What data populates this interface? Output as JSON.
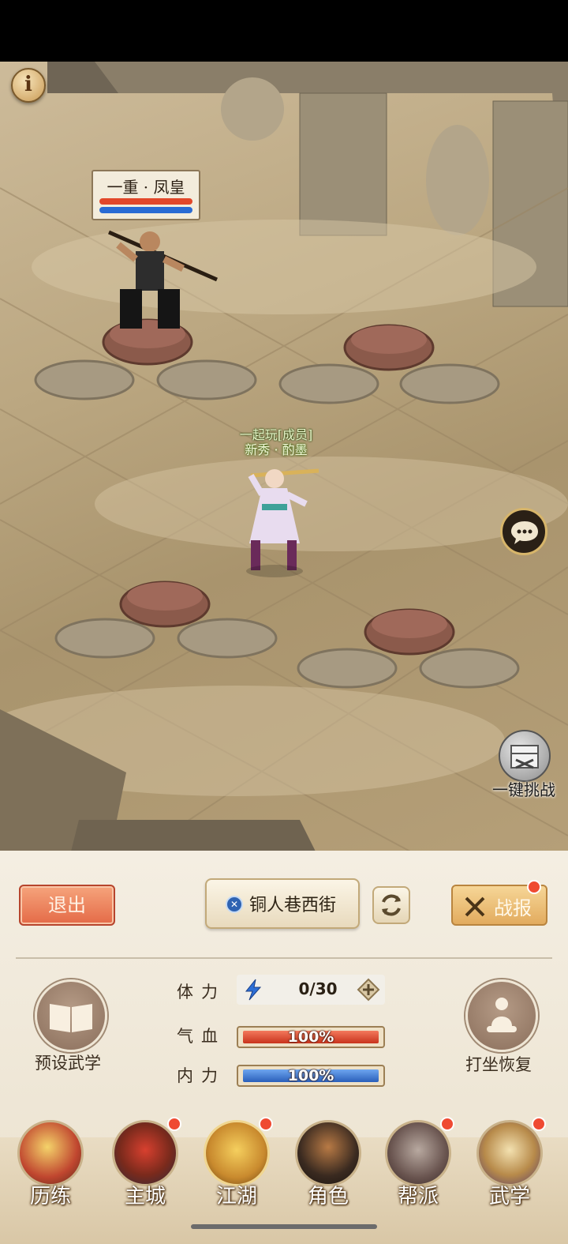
{
  "scene": {
    "enemy": {
      "name": "一重 · 凤皇",
      "hp_percent": 100,
      "mp_percent": 100
    },
    "player": {
      "guild_tag": "一起玩[成员]",
      "name": "新秀 · 酌墨"
    },
    "auto_challenge_label": "一键挑战"
  },
  "controls": {
    "exit_label": "退出",
    "location_label": "铜人巷西街",
    "report_label": "战报"
  },
  "stats": {
    "stamina_label": "体力",
    "stamina_value": "0/30",
    "hp_label": "气血",
    "hp_value": "100%",
    "hp_percent": 100,
    "mp_label": "内力",
    "mp_value": "100%",
    "mp_percent": 100
  },
  "actions": {
    "preset_label": "预设武学",
    "meditate_label": "打坐恢复"
  },
  "nav": [
    {
      "label": "历练",
      "badge": false
    },
    {
      "label": "主城",
      "badge": true
    },
    {
      "label": "江湖",
      "badge": true
    },
    {
      "label": "角色",
      "badge": false
    },
    {
      "label": "帮派",
      "badge": true
    },
    {
      "label": "武学",
      "badge": true
    }
  ],
  "colors": {
    "hp": "#e2472a",
    "mp": "#2a6bd4",
    "badge": "#ef4a32",
    "exit_button": "#e46a47",
    "report_button": "#e2ab5e"
  }
}
